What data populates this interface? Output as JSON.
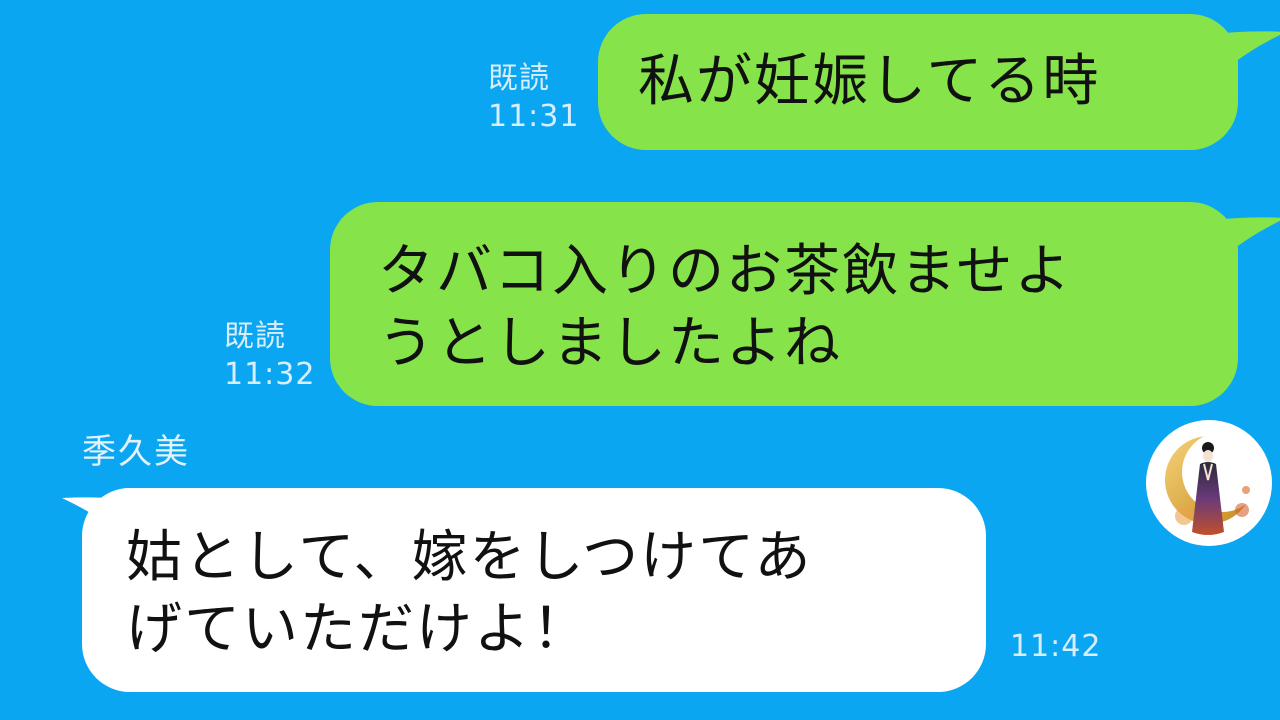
{
  "messages": [
    {
      "direction": "sent",
      "text": "私が妊娠してる時",
      "read_label": "既読",
      "time": "11:31"
    },
    {
      "direction": "sent",
      "text": "タバコ入りのお茶飲ませよ\nうとしましたよね",
      "read_label": "既読",
      "time": "11:32"
    },
    {
      "direction": "received",
      "sender": "季久美",
      "text": "姑として、嫁をしつけてあ\nげていただけよ！",
      "time": "11:42"
    }
  ],
  "avatar": {
    "icon": "kimono-woman-crescent-moon-avatar"
  },
  "colors": {
    "background": "#0aa6f2",
    "sent_bubble": "#86e34a",
    "received_bubble": "#ffffff",
    "meta_text": "#d8eefb"
  }
}
